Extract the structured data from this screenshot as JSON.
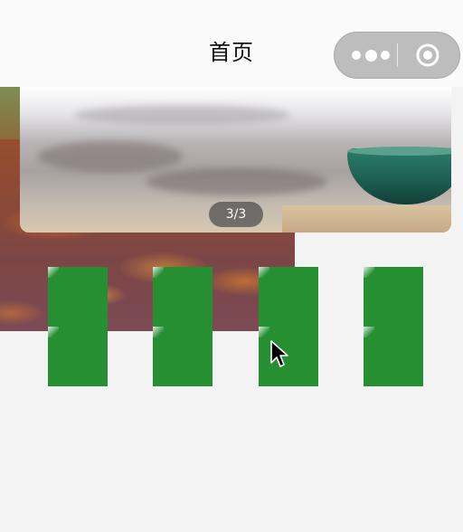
{
  "header": {
    "title": "首页"
  },
  "capsule": {
    "menu_icon": "more-dots-icon",
    "close_icon": "target-circle-icon"
  },
  "banner": {
    "indicator": "3/3"
  },
  "grid": {
    "rows": 2,
    "columns": 4,
    "tile_color": "#258f32"
  },
  "colors": {
    "background": "#f3f3f3",
    "navbar": "#fafafa",
    "capsule": "#bdbdbd"
  }
}
